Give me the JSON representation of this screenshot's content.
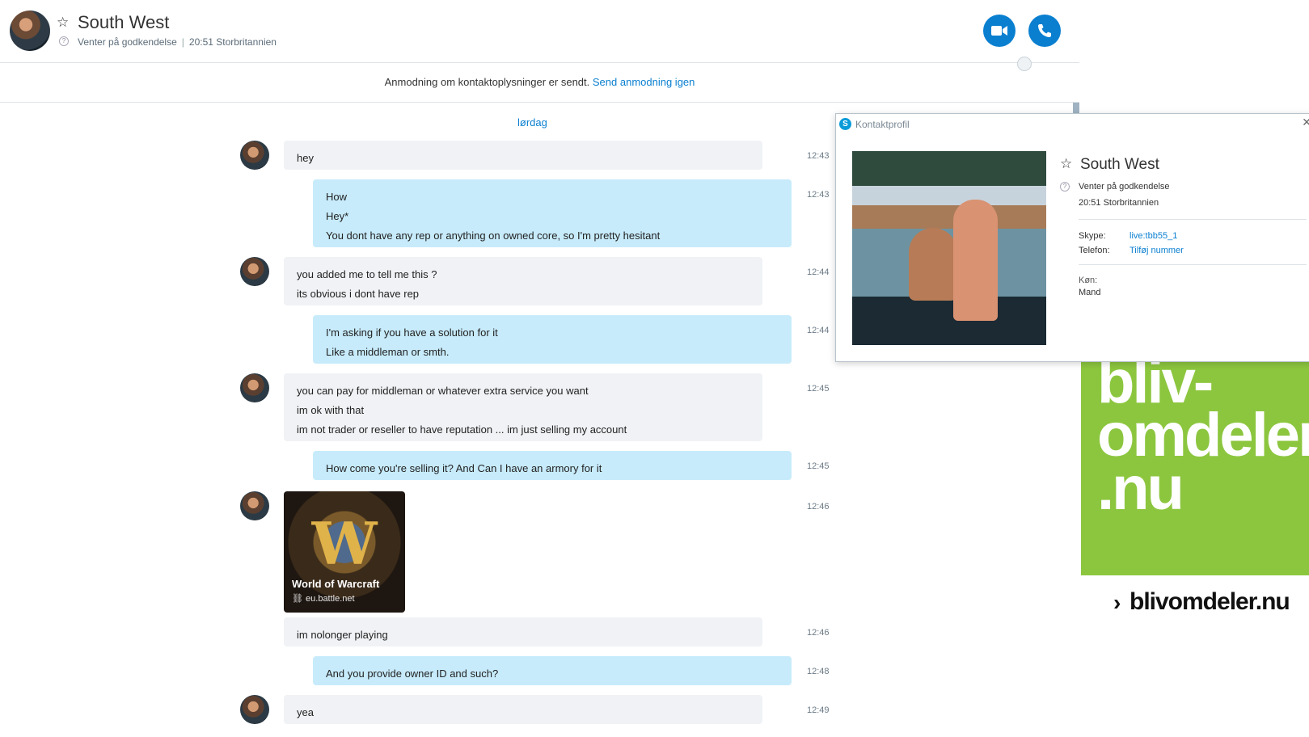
{
  "header": {
    "contact_name": "South West",
    "status": "Venter på godkendelse",
    "local_time": "20:51 Storbritannien",
    "video_call_icon": "video-camera-icon",
    "voice_call_icon": "phone-icon"
  },
  "notice": {
    "text": "Anmodning om kontaktoplysninger er sendt.",
    "link": "Send anmodning igen"
  },
  "chat": {
    "day_label": "lørdag",
    "messages": [
      {
        "dir": "in",
        "lines": [
          "hey"
        ],
        "time": "12:43"
      },
      {
        "dir": "out",
        "lines": [
          "How",
          "Hey*",
          "You dont have any rep or anything on owned core, so I'm pretty hesitant"
        ],
        "time": "12:43"
      },
      {
        "dir": "in",
        "lines": [
          "you added me to tell me this ?",
          "its obvious i dont have rep"
        ],
        "time": "12:44"
      },
      {
        "dir": "out",
        "lines": [
          "I'm asking if you have a solution for it",
          "Like a middleman or smth."
        ],
        "time": "12:44"
      },
      {
        "dir": "in",
        "lines": [
          "you can pay for middleman or whatever extra service you want",
          "im ok with that",
          "im not trader or reseller to have reputation ... im just selling my account"
        ],
        "time": "12:45"
      },
      {
        "dir": "out",
        "lines": [
          "How come you're selling it? And Can I have an armory for it"
        ],
        "time": "12:45"
      },
      {
        "dir": "in",
        "card": {
          "title": "World of Warcraft",
          "url": "eu.battle.net"
        },
        "time": "12:46"
      },
      {
        "dir": "in",
        "lines": [
          "im nolonger playing"
        ],
        "time": "12:46"
      },
      {
        "dir": "out",
        "lines": [
          "And you provide owner ID and such?"
        ],
        "time": "12:48"
      },
      {
        "dir": "in",
        "lines": [
          "yea"
        ],
        "time": "12:49"
      }
    ]
  },
  "profile": {
    "window_title": "Kontaktprofil",
    "name": "South West",
    "status": "Venter på godkendelse",
    "local_time": "20:51 Storbritannien",
    "skype_label": "Skype:",
    "skype_value": "live:tbb55_1",
    "phone_label": "Telefon:",
    "phone_value": "Tilføj nummer",
    "gender_label": "Køn:",
    "gender_value": "Mand"
  },
  "ad": {
    "big_lines": [
      "bliv-",
      "omdeler",
      ".nu"
    ],
    "small": "blivomdeler.nu",
    "colors": {
      "green": "#8cc63f"
    }
  },
  "colors": {
    "accent": "#0a7fd0",
    "incoming_bubble": "#f0f2f5",
    "outgoing_bubble": "#c7ebfb"
  }
}
